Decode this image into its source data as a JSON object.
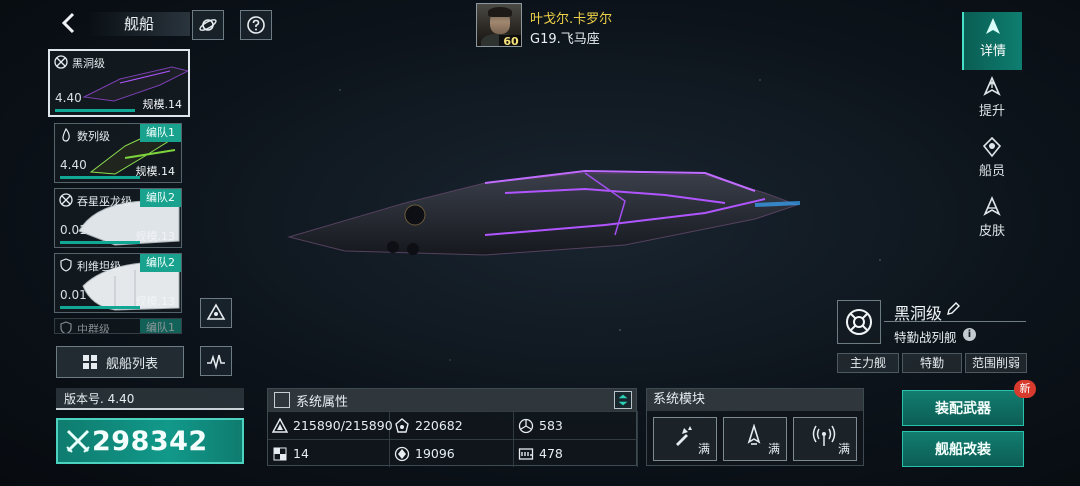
{
  "header": {
    "title": "舰船"
  },
  "commander": {
    "name": "叶戈尔.卡罗尔",
    "server": "G19.飞马座",
    "level": "60"
  },
  "ships": [
    {
      "name": "黑洞级",
      "level": "4.40",
      "scale": "规模.14",
      "fleet": "",
      "icon": "target-icon"
    },
    {
      "name": "数列级",
      "level": "4.40",
      "scale": "规模.14",
      "fleet": "编队1",
      "icon": "flame-icon"
    },
    {
      "name": "吞星巫龙级",
      "level": "0.01",
      "scale": "规模.13",
      "fleet": "编队2",
      "icon": "target-icon"
    },
    {
      "name": "利维坦级",
      "level": "0.01",
      "scale": "规模.13",
      "fleet": "编队2",
      "icon": "shield-icon"
    },
    {
      "name": "中群级",
      "fleet": "编队1",
      "icon": "shield-icon"
    }
  ],
  "ship_list_button": "舰船列表",
  "version": "版本号. 4.40",
  "power": "298342",
  "attributes": {
    "title": "系统属性",
    "items": [
      {
        "icon": "hull-icon",
        "value": "215890/215890"
      },
      {
        "icon": "armor-icon",
        "value": "220682"
      },
      {
        "icon": "energy-icon",
        "value": "583"
      },
      {
        "icon": "checker-icon",
        "value": "14"
      },
      {
        "icon": "shield-core-icon",
        "value": "19096"
      },
      {
        "icon": "speed-icon",
        "value": "478"
      }
    ]
  },
  "modules": {
    "title": "系统模块",
    "slots": [
      {
        "icon": "weapon-module-icon",
        "status": "满"
      },
      {
        "icon": "ship-module-icon",
        "status": "满"
      },
      {
        "icon": "antenna-module-icon",
        "status": "满"
      }
    ]
  },
  "actions": {
    "equip_weapons": "装配武器",
    "modify_ship": "舰船改装",
    "new_badge": "新"
  },
  "nav": [
    {
      "label": "详情",
      "icon": "details-icon",
      "active": true
    },
    {
      "label": "提升",
      "icon": "upgrade-icon",
      "active": false
    },
    {
      "label": "船员",
      "icon": "crew-icon",
      "active": false
    },
    {
      "label": "皮肤",
      "icon": "skin-icon",
      "active": false
    }
  ],
  "ship_info": {
    "name": "黑洞级",
    "class": "特勤战列舰",
    "tags": [
      "主力舰",
      "特勤",
      "范围削弱"
    ]
  },
  "colors": {
    "accent": "#12a694",
    "name_gold": "#f0d24a",
    "glow_purple": "#b055ff"
  }
}
